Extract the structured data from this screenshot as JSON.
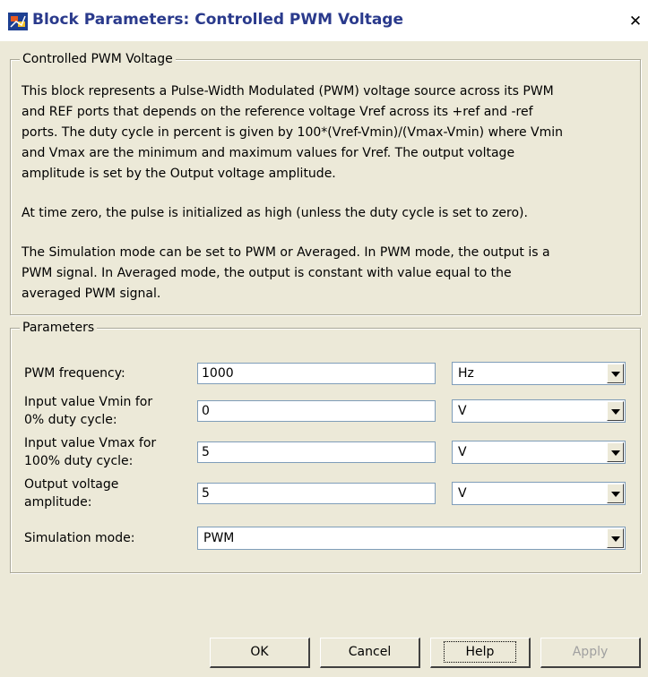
{
  "window": {
    "title": "Block Parameters: Controlled PWM Voltage",
    "close_glyph": "✕",
    "app_icon": "simulink-block-icon"
  },
  "description_group": {
    "legend": "Controlled PWM Voltage",
    "paragraph1_lines": [
      "This block represents a Pulse-Width Modulated (PWM) voltage source across its PWM",
      "and REF ports that depends on the reference voltage Vref across its +ref and -ref",
      "ports. The duty cycle in percent is given by 100*(Vref-Vmin)/(Vmax-Vmin) where Vmin",
      "and Vmax are the minimum and maximum values for Vref. The output voltage",
      "amplitude is set by the Output voltage amplitude."
    ],
    "paragraph2": "At time zero, the pulse is initialized as high (unless the duty cycle is set to zero).",
    "paragraph3_lines": [
      "The Simulation mode can be set to PWM or Averaged. In PWM mode, the output is a",
      "PWM signal. In Averaged mode, the output is constant with value equal to the",
      "averaged PWM signal."
    ]
  },
  "parameters_group": {
    "legend": "Parameters",
    "rows": [
      {
        "label_lines": [
          "PWM frequency:"
        ],
        "value": "1000",
        "unit": "Hz"
      },
      {
        "label_lines": [
          "Input value Vmin for",
          "0% duty cycle:"
        ],
        "value": "0",
        "unit": "V"
      },
      {
        "label_lines": [
          "Input value Vmax for",
          "100% duty cycle:"
        ],
        "value": "5",
        "unit": "V"
      },
      {
        "label_lines": [
          "Output voltage",
          "amplitude:"
        ],
        "value": "5",
        "unit": "V"
      }
    ],
    "simulation_mode": {
      "label": "Simulation mode:",
      "value": "PWM"
    }
  },
  "buttons": {
    "ok": "OK",
    "cancel": "Cancel",
    "help": "Help",
    "apply": "Apply"
  }
}
